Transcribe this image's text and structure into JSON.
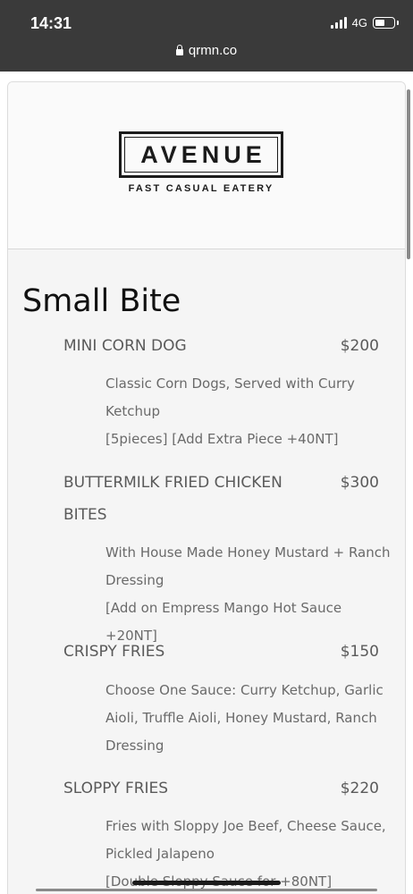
{
  "status_bar": {
    "time": "14:31",
    "network": "4G",
    "battery_level": 0.5
  },
  "browser": {
    "url": "qrmn.co"
  },
  "logo": {
    "name": "AVENUE",
    "tagline": "FAST CASUAL EATERY"
  },
  "section": {
    "title": "Small Bite"
  },
  "items": [
    {
      "name": "MINI CORN DOG",
      "price": "$200",
      "desc": [
        "Classic Corn Dogs, Served with Curry",
        "Ketchup",
        "[5pieces] [Add Extra Piece +40NT]"
      ]
    },
    {
      "name": "BUTTERMILK FRIED CHICKEN",
      "name2": "BITES",
      "price": "$300",
      "desc": [
        "With House Made Honey Mustard + Ranch",
        "Dressing",
        "[Add on Empress Mango Hot Sauce +20NT]"
      ]
    },
    {
      "name": "CRISPY FRIES",
      "price": "$150",
      "desc": [
        "Choose One Sauce: Curry Ketchup, Garlic",
        "Aioli, Truffle Aioli, Honey Mustard, Ranch",
        "Dressing"
      ]
    },
    {
      "name": "SLOPPY FRIES",
      "price": "$220",
      "desc": [
        "Fries with Sloppy Joe Beef, Cheese Sauce,",
        "Pickled Jalapeno",
        "[Double Sloppy Sauce for +80NT]"
      ]
    }
  ]
}
